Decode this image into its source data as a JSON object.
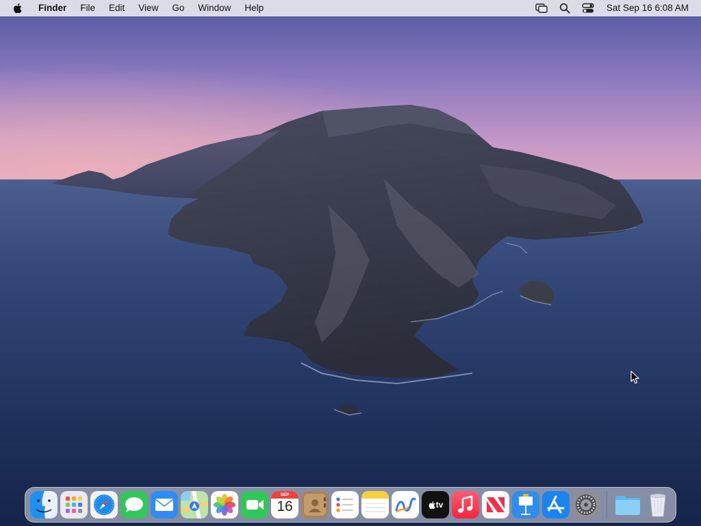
{
  "menubar": {
    "apple_icon": "apple-logo-icon",
    "app_name": "Finder",
    "menus": [
      "File",
      "Edit",
      "View",
      "Go",
      "Window",
      "Help"
    ],
    "status_icons": [
      "screen-mirroring-icon",
      "spotlight-search-icon",
      "control-center-icon"
    ],
    "clock": "Sat Sep 16  6:08 AM"
  },
  "desktop": {
    "wallpaper": "Catalina island wallpaper",
    "colors": {
      "sky_top": "#5d5ea8",
      "sky_horizon": "#c996c8",
      "sea": "#1c2c52"
    }
  },
  "dock": {
    "apps": [
      {
        "name": "Finder",
        "icon": "finder-icon",
        "running": true
      },
      {
        "name": "Launchpad",
        "icon": "launchpad-icon"
      },
      {
        "name": "Safari",
        "icon": "safari-icon"
      },
      {
        "name": "Messages",
        "icon": "messages-icon"
      },
      {
        "name": "Mail",
        "icon": "mail-icon"
      },
      {
        "name": "Maps",
        "icon": "maps-icon"
      },
      {
        "name": "Photos",
        "icon": "photos-icon"
      },
      {
        "name": "FaceTime",
        "icon": "facetime-icon"
      },
      {
        "name": "Calendar",
        "icon": "calendar-icon",
        "month": "SEP",
        "day": "16"
      },
      {
        "name": "Contacts",
        "icon": "contacts-icon"
      },
      {
        "name": "Reminders",
        "icon": "reminders-icon"
      },
      {
        "name": "Notes",
        "icon": "notes-icon"
      },
      {
        "name": "Freeform",
        "icon": "freeform-icon"
      },
      {
        "name": "TV",
        "icon": "tv-icon",
        "label": "tv"
      },
      {
        "name": "Music",
        "icon": "music-icon"
      },
      {
        "name": "News",
        "icon": "news-icon"
      },
      {
        "name": "Keynote",
        "icon": "keynote-icon"
      },
      {
        "name": "App Store",
        "icon": "app-store-icon"
      },
      {
        "name": "System Settings",
        "icon": "system-settings-icon"
      }
    ],
    "others": [
      {
        "name": "Downloads",
        "icon": "folder-icon"
      },
      {
        "name": "Trash",
        "icon": "trash-icon"
      }
    ]
  }
}
